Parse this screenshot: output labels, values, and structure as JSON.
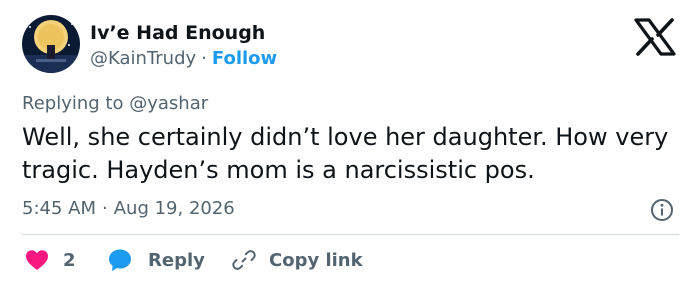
{
  "author": {
    "display_name": "Iv’e Had Enough",
    "handle": "@KainTrudy",
    "separator": "·",
    "follow_label": "Follow"
  },
  "reply_context": {
    "prefix": "Replying to",
    "mention": "@yashar"
  },
  "tweet": {
    "text": "Well, she certainly didn’t love her daughter. How very tragic. Hayden’s mom is a narcissistic pos.",
    "time": "5:45 AM",
    "separator": "·",
    "date": "Aug 19, 2026"
  },
  "actions": {
    "like_count": "2",
    "reply_label": "Reply",
    "copy_label": "Copy link"
  },
  "colors": {
    "accent": "#1d9bf0",
    "like": "#f91880",
    "text": "#0f1419",
    "muted": "#536471",
    "divider": "#cfd9de"
  },
  "icons": {
    "brand": "x-logo-icon",
    "info": "info-icon",
    "like": "heart-icon",
    "reply": "speech-bubble-icon",
    "copy": "link-icon"
  }
}
